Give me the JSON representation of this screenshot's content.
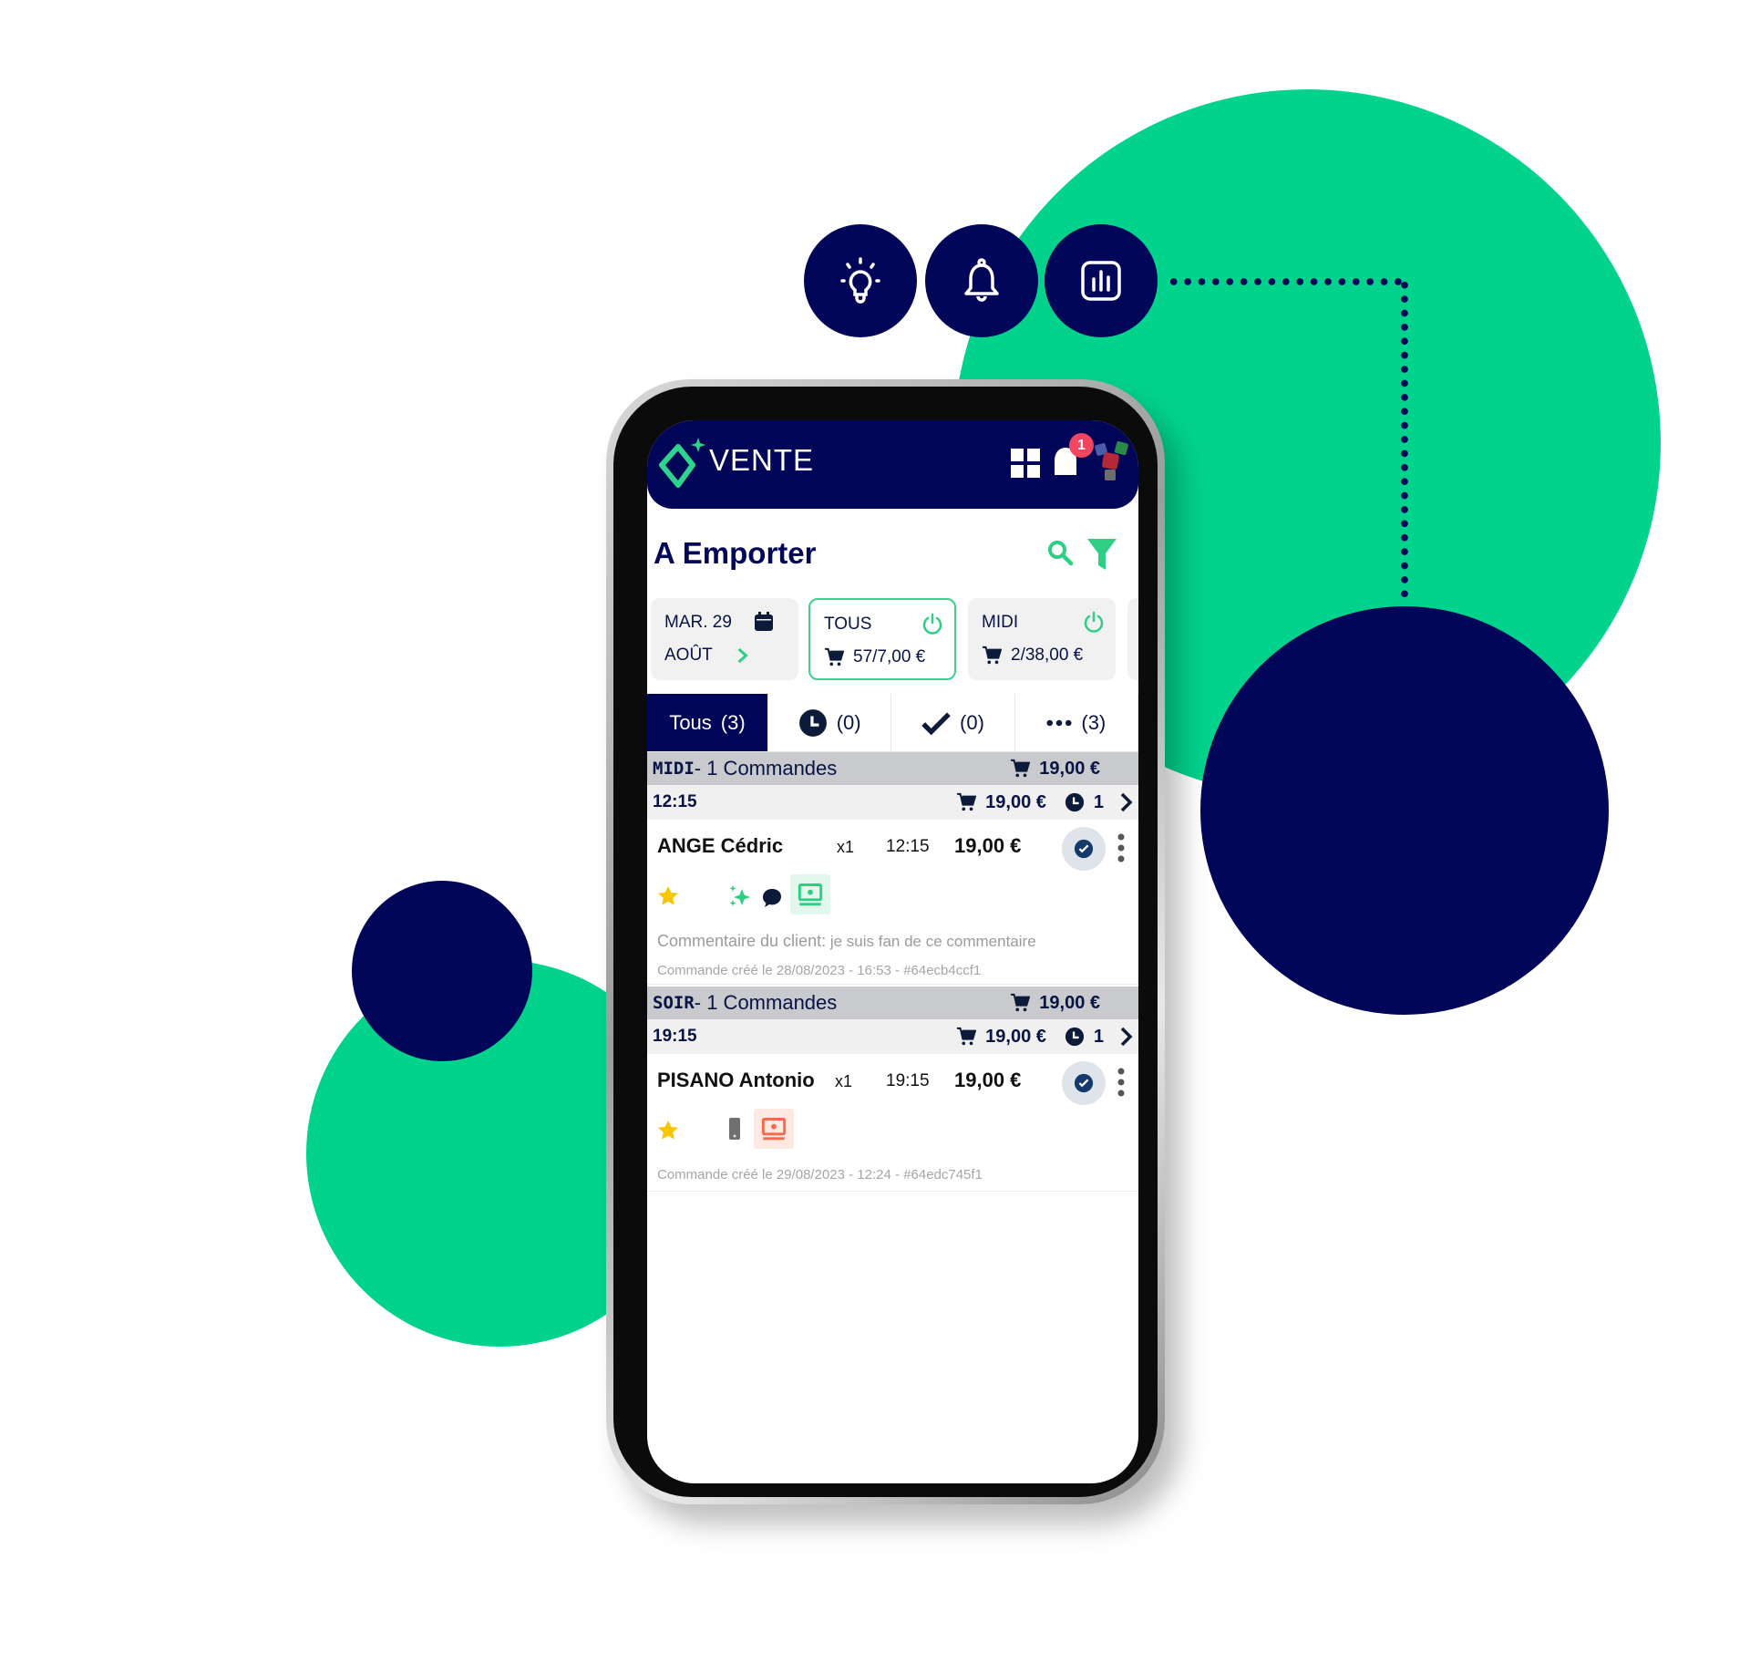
{
  "colors": {
    "green": "#02d38c",
    "navy": "#020658",
    "badge": "#f0465f",
    "accent_green": "#3ccf8d"
  },
  "features": [
    {
      "icon": "lightbulb-icon"
    },
    {
      "icon": "bell-icon"
    },
    {
      "icon": "chart-icon"
    }
  ],
  "header": {
    "app_name": "VENTE",
    "notification_count": "1",
    "icons": [
      "grid-icon",
      "bell-icon",
      "avatar-dice"
    ]
  },
  "page": {
    "title": "A Emporter",
    "actions": [
      "search-icon",
      "filter-icon"
    ]
  },
  "cards": {
    "date": {
      "day": "MAR. 29",
      "month": "AOÛT"
    },
    "all": {
      "label": "TOUS",
      "value": "57/7,00 €"
    },
    "midi": {
      "label": "MIDI",
      "value": "2/38,00 €"
    }
  },
  "tabs": [
    {
      "label": "Tous",
      "count": "(3)"
    },
    {
      "icon": "clock-icon",
      "count": "(0)"
    },
    {
      "icon": "check-icon",
      "count": "(0)"
    },
    {
      "icon": "dots-icon",
      "count": "(3)"
    }
  ],
  "groups": [
    {
      "name": "MIDI",
      "summary": " - 1 Commandes",
      "total": "19,00 €",
      "slot": {
        "time": "12:15",
        "total": "19,00 €",
        "pending": "1"
      },
      "order": {
        "name": "ANGE Cédric",
        "qty": "x1",
        "time": "12:15",
        "price": "19,00 €",
        "comment_label": "Commentaire du client:",
        "comment": " je suis fan de ce commentaire",
        "created": "Commande créé le 28/08/2023 - 16:53 - #64ecb4ccf1"
      }
    },
    {
      "name": "SOIR",
      "summary": " - 1 Commandes",
      "total": "19,00 €",
      "slot": {
        "time": "19:15",
        "total": "19,00 €",
        "pending": "1"
      },
      "order": {
        "name": "PISANO Antonio",
        "qty": "x1",
        "time": "19:15",
        "price": "19,00 €",
        "created": "Commande créé le 29/08/2023 - 12:24 - #64edc745f1"
      }
    }
  ]
}
